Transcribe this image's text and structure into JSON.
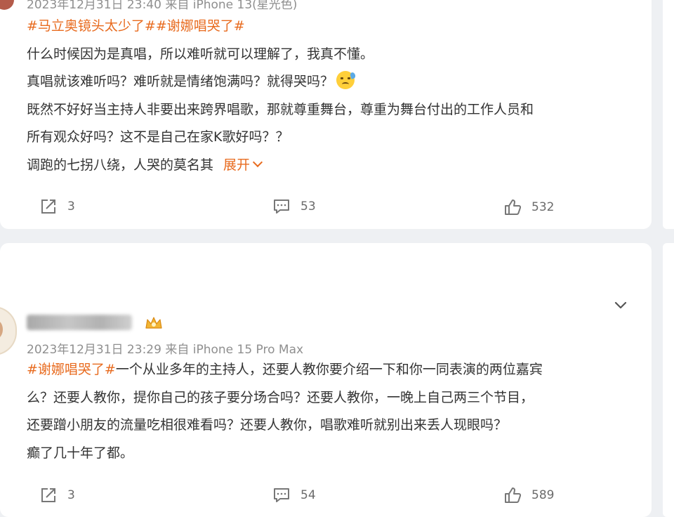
{
  "posts": [
    {
      "meta": "2023年12月31日 23:40  来自 iPhone 13(星光色)",
      "tags": "#马立奥镜头太少了##谢娜唱哭了#",
      "lines": [
        "什么时候因为是真唱，所以难听就可以理解了，我真不懂。",
        "真唱就该难听吗？难听就是情绪饱满吗？就得哭吗？",
        "既然不好好当主持人非要出来跨界唱歌，那就尊重舞台，尊重为舞台付出的工作人员和",
        "所有观众好吗？这不是自己在家K歌好吗？？",
        "调跑的七拐八绕，人哭的莫名其"
      ],
      "expand_label": "展开",
      "emoji": "cold-sweat-emoji",
      "share_count": "3",
      "comment_count": "53",
      "like_count": "532"
    },
    {
      "meta": "2023年12月31日 23:29  来自 iPhone 15 Pro Max",
      "tag": "#谢娜唱哭了#",
      "lines": [
        "一个从业多年的主持人，还要人教你要介绍一下和你一同表演的两位嘉宾",
        "么？还要人教你，提你自己的孩子要分场合吗？还要人教你，一晚上自己两三个节目，",
        "还要蹭小朋友的流量吃相很难看吗？还要人教你，唱歌难听就别出来丢人现眼吗？",
        "癫了几十年了都。"
      ],
      "share_count": "3",
      "comment_count": "54",
      "like_count": "589"
    }
  ],
  "icons": {
    "share": "share-icon",
    "comment": "comment-icon",
    "like": "thumbs-up-icon",
    "menu": "chevron-down-icon",
    "badge": "crown-badge-icon"
  },
  "colors": {
    "accent": "#e86b1f",
    "background": "#eef0f3",
    "card": "#ffffff"
  }
}
